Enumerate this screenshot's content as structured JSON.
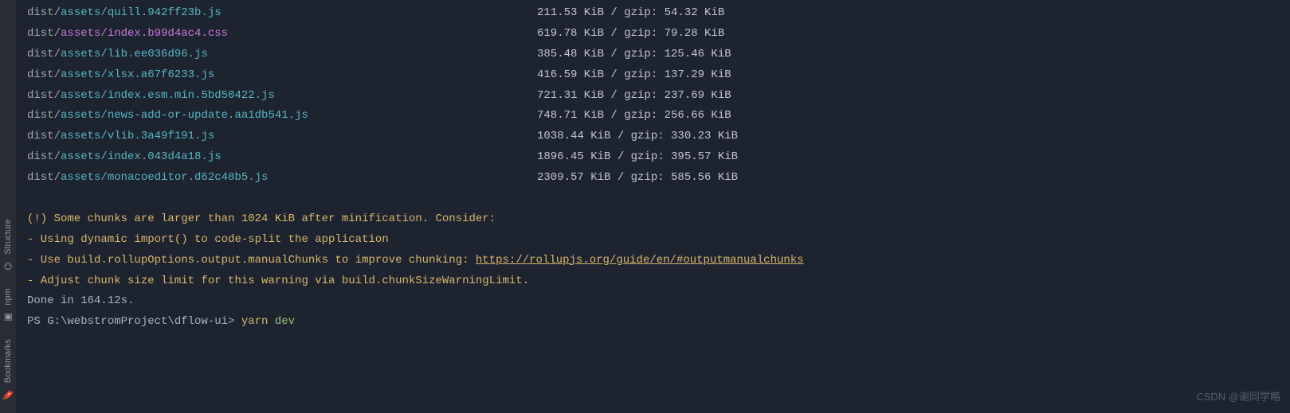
{
  "sidebar": {
    "items": [
      {
        "label": "Bookmarks",
        "icon": "🔖"
      },
      {
        "label": "npm",
        "icon": "▣"
      },
      {
        "label": "Structure",
        "icon": "⌬"
      }
    ]
  },
  "files": [
    {
      "prefix": "dist/",
      "path": "assets/quill.942ff23b.js",
      "type": "js",
      "size": "211.53 KiB / gzip: 54.32 KiB"
    },
    {
      "prefix": "dist/",
      "path": "assets/index.b99d4ac4.css",
      "type": "css",
      "size": "619.78 KiB / gzip: 79.28 KiB"
    },
    {
      "prefix": "dist/",
      "path": "assets/lib.ee036d96.js",
      "type": "js",
      "size": "385.48 KiB / gzip: 125.46 KiB"
    },
    {
      "prefix": "dist/",
      "path": "assets/xlsx.a67f6233.js",
      "type": "js",
      "size": "416.59 KiB / gzip: 137.29 KiB"
    },
    {
      "prefix": "dist/",
      "path": "assets/index.esm.min.5bd50422.js",
      "type": "js",
      "size": "721.31 KiB / gzip: 237.69 KiB"
    },
    {
      "prefix": "dist/",
      "path": "assets/news-add-or-update.aa1db541.js",
      "type": "js",
      "size": "748.71 KiB / gzip: 256.66 KiB"
    },
    {
      "prefix": "dist/",
      "path": "assets/vlib.3a49f191.js",
      "type": "js",
      "size": "1038.44 KiB / gzip: 330.23 KiB"
    },
    {
      "prefix": "dist/",
      "path": "assets/index.043d4a18.js",
      "type": "js",
      "size": "1896.45 KiB / gzip: 395.57 KiB"
    },
    {
      "prefix": "dist/",
      "path": "assets/monacoeditor.d62c48b5.js",
      "type": "js",
      "size": "2309.57 KiB / gzip: 585.56 KiB"
    }
  ],
  "warnings": {
    "header": "(!) Some chunks are larger than 1024 KiB after minification. Consider:",
    "line1": "- Using dynamic import() to code-split the application",
    "line2_pre": "- Use build.rollupOptions.output.manualChunks to improve chunking: ",
    "line2_link": "https://rollupjs.org/guide/en/#outputmanualchunks",
    "line3": "- Adjust chunk size limit for this warning via build.chunkSizeWarningLimit."
  },
  "done": "Done in 164.12s.",
  "prompt": {
    "path": "PS G:\\webstromProject\\dflow-ui> ",
    "cmd": "yarn",
    "arg": " dev"
  },
  "watermark": "CSDN @谢同学略"
}
